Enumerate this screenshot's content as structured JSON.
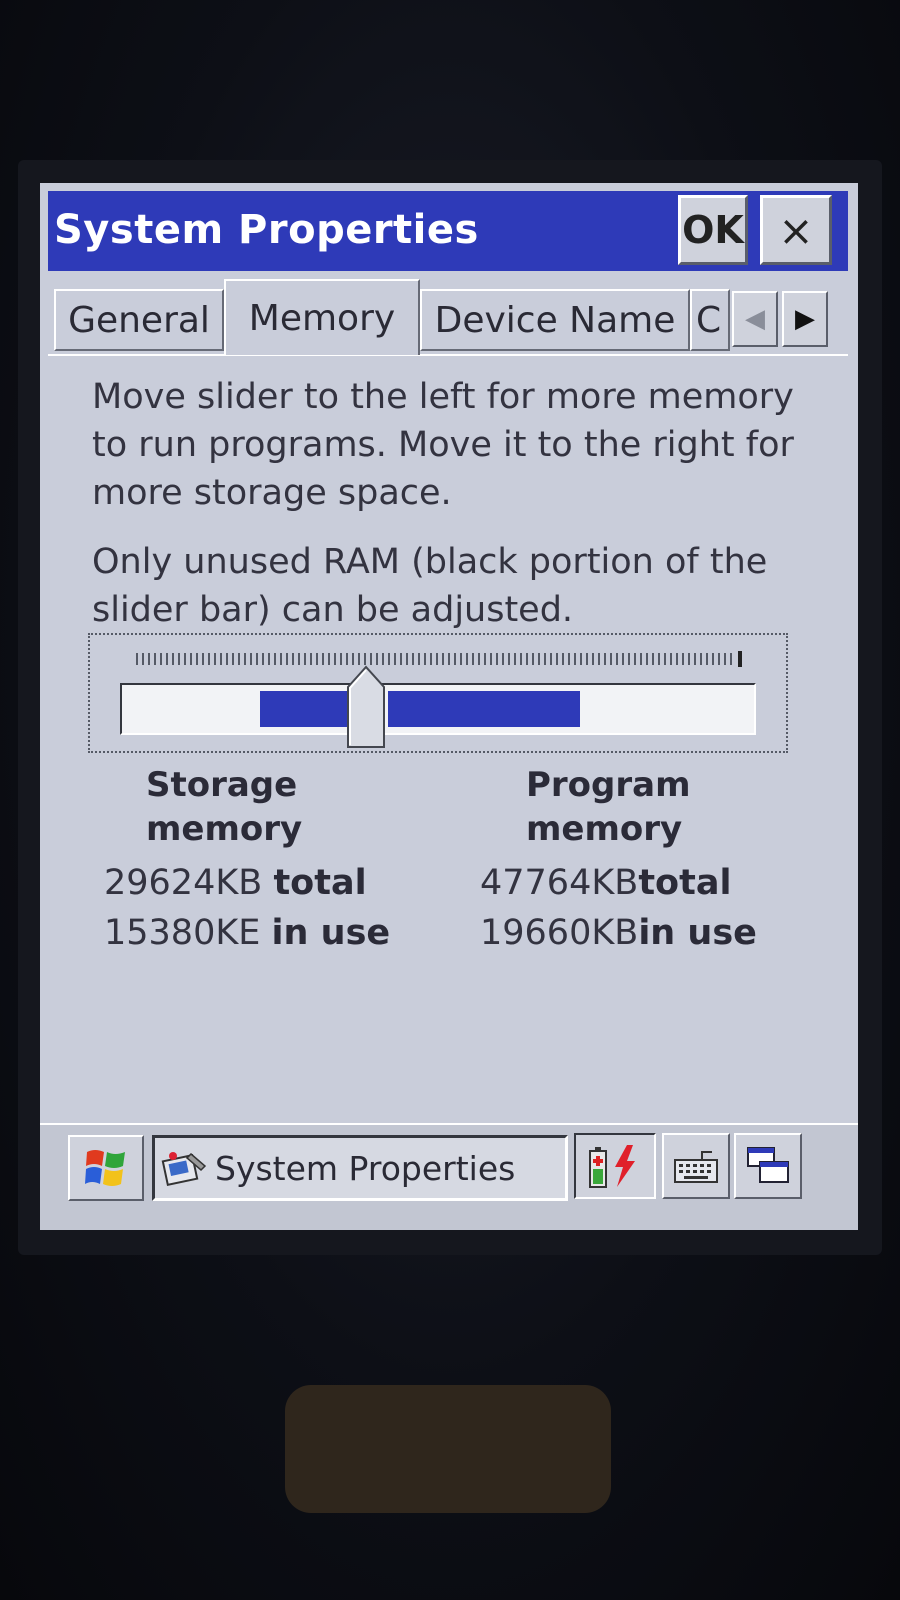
{
  "window": {
    "title": "System Properties",
    "ok_label": "OK",
    "close_label": "×"
  },
  "tabs": [
    {
      "label": "General",
      "active": false
    },
    {
      "label": "Memory",
      "active": true
    },
    {
      "label": "Device Name",
      "active": false
    },
    {
      "label": "C",
      "active": false
    }
  ],
  "memory": {
    "instructions": "Move slider to the left for more memory to run programs. Move it to the right for more storage space.",
    "note": "Only unused RAM (black portion of the slider bar) can be adjusted.",
    "storage": {
      "heading": "Storage memory",
      "total_value": "29624KB",
      "total_label": "total",
      "in_use_value": "15380KE",
      "in_use_label": "in use"
    },
    "program": {
      "heading": "Program memory",
      "total_value": "47764KB",
      "total_label": "total",
      "in_use_value": "19660KB",
      "in_use_label": "in use"
    }
  },
  "taskbar": {
    "active_task": "System Properties"
  },
  "colors": {
    "titlebar": "#2e3ab8",
    "window_bg": "#c9cdda",
    "slider_fill": "#2e3ab8"
  }
}
